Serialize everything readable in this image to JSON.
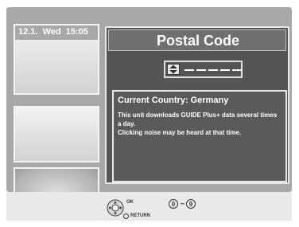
{
  "header": {
    "datetime": "12.1.  Wed  15:05"
  },
  "dialog": {
    "title": "Postal Code",
    "postal_input": {
      "slots": 5
    },
    "info": {
      "heading": "Current Country: Germany",
      "lines": [
        "This unit downloads GUIDE Plus+ data several times a day.",
        "Clicking noise may be heard at that time."
      ]
    }
  },
  "footer": {
    "ok_label": "OK",
    "return_label": "RETURN",
    "digit_start": "0",
    "digit_tilde": "~",
    "digit_end": "9"
  },
  "icons": {
    "updown": "up-down-arrow-icon",
    "remote": "remote-cursor-icon",
    "return": "return-icon"
  }
}
